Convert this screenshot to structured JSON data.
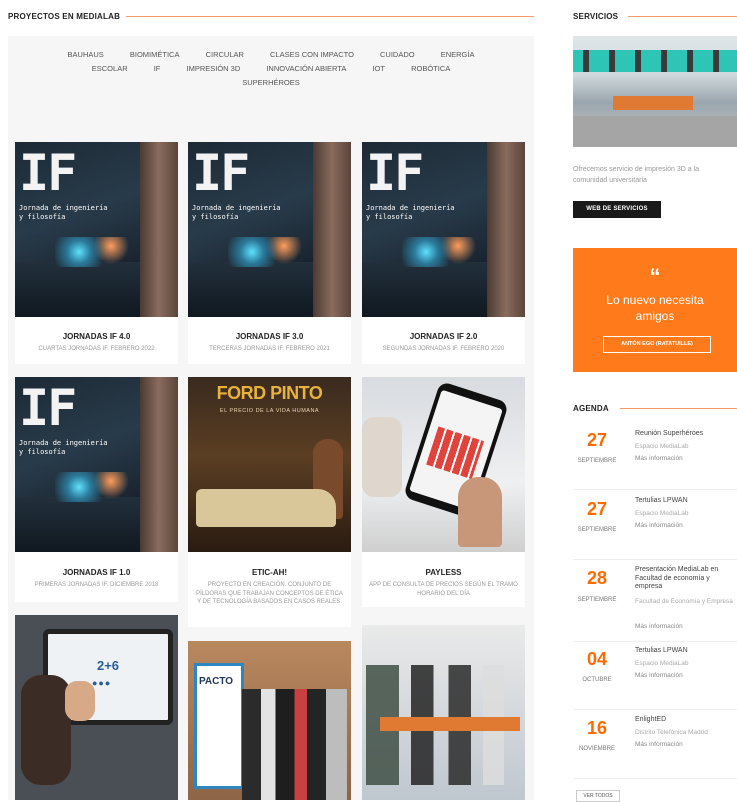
{
  "projects": {
    "title": "PROYECTOS EN MEDIALAB",
    "filters_row1": [
      "BAUHAUS",
      "BIOMIMÉTICA",
      "CIRCULAR",
      "CLASES CON IMPACTO",
      "CUIDADO",
      "ENERGÍA"
    ],
    "filters_row2": [
      "ESCOLAR",
      "IF",
      "IMPRESIÓN 3D",
      "INNOVACIÓN ABIERTA",
      "IOT",
      "ROBÓTICA"
    ],
    "filters_row3": [
      "SUPERHÉROES"
    ],
    "if_image": {
      "big": "IF",
      "line1": "Jornada de ingeniería",
      "line2": "y filosofía"
    },
    "cards": [
      {
        "title": "JORNADAS IF 4.0",
        "subtitle": "CUARTAS JORNADAS IF. FEBRERO 2022"
      },
      {
        "title": "JORNADAS IF 3.0",
        "subtitle": "TERCERAS JORNADAS IF. FEBRERO 2021"
      },
      {
        "title": "JORNADAS IF 2.0",
        "subtitle": "SEGUNDAS JORNADAS IF. FEBRERO 2020"
      },
      {
        "title": "JORNADAS IF 1.0",
        "subtitle": "PRIMERAS JORNADAS IF. DICIEMBRE 2018"
      },
      {
        "title": "ETIC-AH!",
        "subtitle": "PROYECTO EN CREACIÓN. CONJUNTO DE PÍLDORAS QUE TRABAJAN CONCEPTOS DE ÉTICA Y DE TECNOLOGÍA BASADOS EN CASOS REALES."
      },
      {
        "title": "PAYLESS",
        "subtitle": "APP DE CONSULTA DE PRECIOS SEGÚN EL TRAMO HORARIO DEL DÍA"
      }
    ],
    "ford_image": {
      "title": "FORD PINTO",
      "subtitle": "EL PRECIO DE LA VIDA HUMANA"
    },
    "tablet_image": {
      "equation": "2+6",
      "answer": "●●●"
    },
    "event_image": {
      "banner": "PACTO"
    }
  },
  "services": {
    "title": "SERVICIOS",
    "text": "Ofrecemos servicio de impresión 3D a la comunidad universitaria",
    "button": "WEB DE SERVICIOS"
  },
  "quote": {
    "mark": "“",
    "text_line1": "Lo nuevo necesita",
    "text_line2": "amigos",
    "author": "ANTÓN EGO (RATATUILLE)"
  },
  "agenda": {
    "title": "AGENDA",
    "events": [
      {
        "day": "27",
        "month": "SEPTIEMBRE",
        "title": "Reunión Superhéroes",
        "location": "Espacio MediaLab",
        "more": "Más información"
      },
      {
        "day": "27",
        "month": "SEPTIEMBRE",
        "title": "Tertulias LPWAN",
        "location": "Espacio MediaLab",
        "more": "Más información"
      },
      {
        "day": "28",
        "month": "SEPTIEMBRE",
        "title": "Presentación MediaLab en Facultad de economía y empresa",
        "location": "Facultad de Economía y Empresa",
        "more": "Más información"
      },
      {
        "day": "04",
        "month": "OCTUBRE",
        "title": "Tertulias LPWAN",
        "location": "Espacio MediaLab",
        "more": "Más información"
      },
      {
        "day": "16",
        "month": "NOVIEMBRE",
        "title": "EnlightED",
        "location": "Distrito Telefónica Madrid",
        "more": "Más información"
      }
    ],
    "see_all": "VER TODOS"
  }
}
